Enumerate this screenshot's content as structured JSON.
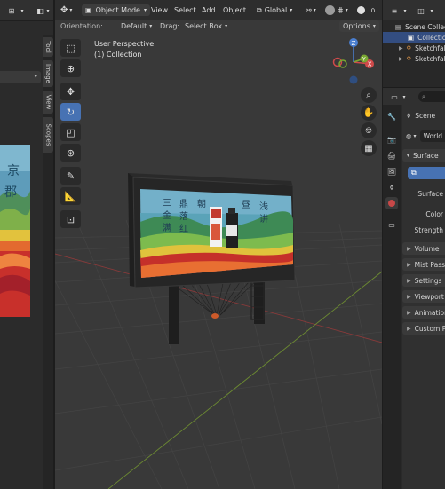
{
  "left_editor": {
    "tabs": [
      "Tool",
      "Image",
      "View",
      "Scopes"
    ]
  },
  "viewport": {
    "mode": "Object Mode",
    "menus": [
      "View",
      "Select",
      "Add",
      "Object"
    ],
    "transform_orientation": "Global",
    "orientation_label": "Orientation:",
    "orientation_value": "Default",
    "drag_label": "Drag:",
    "drag_value": "Select Box",
    "options_label": "Options",
    "perspective_label": "User Perspective",
    "collection_label": "(1) Collection",
    "gizmo_labels": {
      "x": "X",
      "y": "Y",
      "z": "Z"
    },
    "billboard_text": [
      "三",
      "鼎",
      "金",
      "落",
      "满",
      "红",
      "朝",
      "昼",
      "浅",
      "讲"
    ]
  },
  "outliner": {
    "items": [
      "Scene Collection",
      "Collection",
      "Sketchfab",
      "Sketchfab"
    ]
  },
  "properties": {
    "search_placeholder": "",
    "breadcrumb": "Scene",
    "world_name": "World",
    "surface_section": "Surface",
    "surface_label": "Surface",
    "color_label": "Color",
    "strength_label": "Strength",
    "sections": [
      "Volume",
      "Mist Pass",
      "Settings",
      "Viewport",
      "Animation",
      "Custom P"
    ]
  }
}
